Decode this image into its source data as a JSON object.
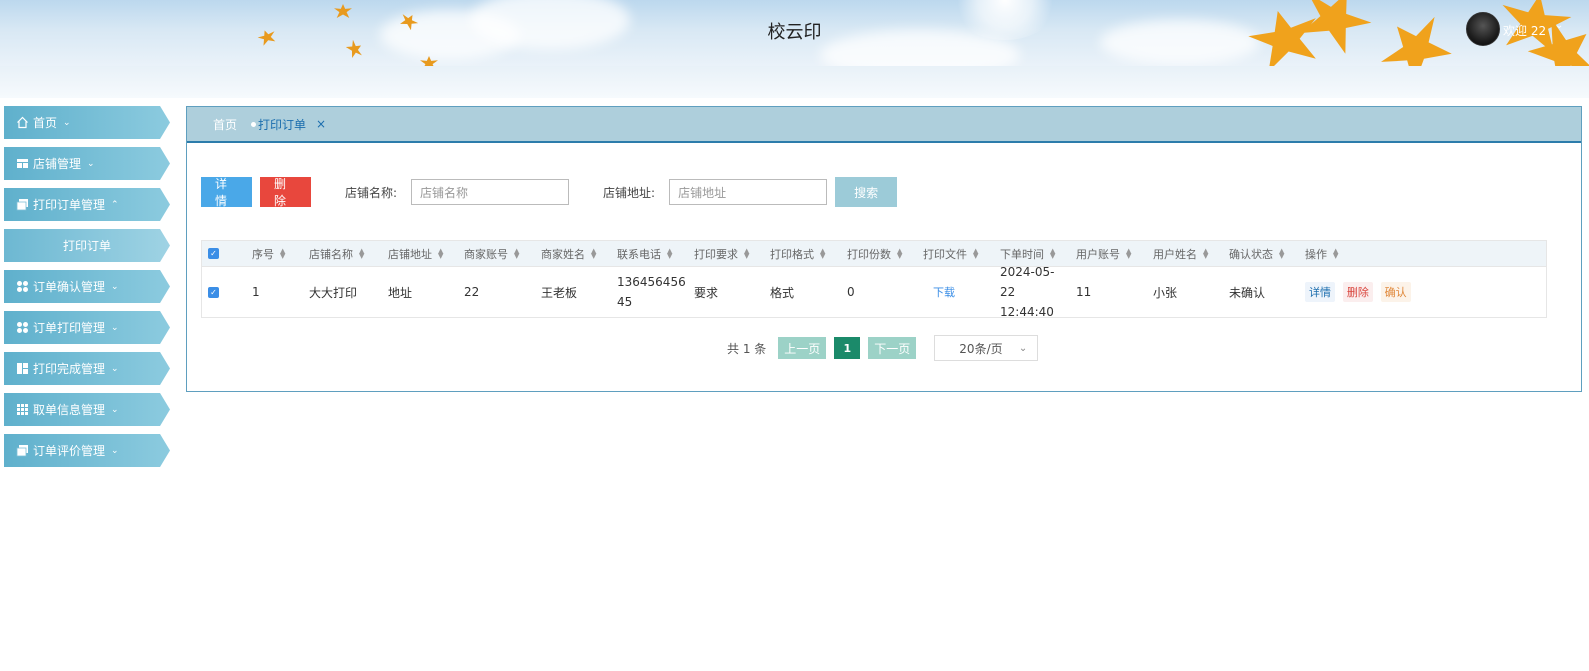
{
  "app": {
    "title": "校云印",
    "welcome": "欢迎 22"
  },
  "sidebar": {
    "items": [
      {
        "label": "首页",
        "icon": "home-icon",
        "chevron": "⌄"
      },
      {
        "label": "店铺管理",
        "icon": "store-icon",
        "chevron": "⌄"
      },
      {
        "label": "打印订单管理",
        "icon": "files-icon",
        "chevron": "⌃"
      },
      {
        "label": "打印订单",
        "icon": "",
        "chevron": ""
      },
      {
        "label": "订单确认管理",
        "icon": "grid-icon",
        "chevron": "⌄"
      },
      {
        "label": "订单打印管理",
        "icon": "grid-icon",
        "chevron": "⌄"
      },
      {
        "label": "打印完成管理",
        "icon": "layout-icon",
        "chevron": "⌄"
      },
      {
        "label": "取单信息管理",
        "icon": "apps-icon",
        "chevron": "⌄"
      },
      {
        "label": "订单评价管理",
        "icon": "files-icon",
        "chevron": "⌄"
      }
    ]
  },
  "tabs": {
    "home": "首页",
    "active": "打印订单",
    "close": "×"
  },
  "toolbar": {
    "detail": "详情",
    "delete": "删除",
    "shop_name_label": "店铺名称:",
    "shop_name_placeholder": "店铺名称",
    "shop_addr_label": "店铺地址:",
    "shop_addr_placeholder": "店铺地址",
    "search": "搜索"
  },
  "table": {
    "headers": [
      "序号",
      "店铺名称",
      "店铺地址",
      "商家账号",
      "商家姓名",
      "联系电话",
      "打印要求",
      "打印格式",
      "打印份数",
      "打印文件",
      "下单时间",
      "用户账号",
      "用户姓名",
      "确认状态",
      "操作"
    ],
    "rows": [
      {
        "index": "1",
        "shop_name": "大大打印",
        "shop_addr": "地址",
        "merchant_account": "22",
        "merchant_name": "王老板",
        "phone": "13645645645",
        "requirement": "要求",
        "format": "格式",
        "copies": "0",
        "file": "下载",
        "order_time": "2024-05-22 12:44:40",
        "user_account": "11",
        "user_name": "小张",
        "status": "未确认",
        "actions": {
          "detail": "详情",
          "delete": "删除",
          "confirm": "确认"
        }
      }
    ]
  },
  "pager": {
    "total": "共 1 条",
    "prev": "上一页",
    "page": "1",
    "next": "下一页",
    "size": "20条/页"
  },
  "colors": {
    "accent": "#2c7cab",
    "sidebar": "#6db8d2",
    "primary": "#4aa8e8",
    "danger": "#e8473d",
    "page_active": "#1b8a6a"
  }
}
